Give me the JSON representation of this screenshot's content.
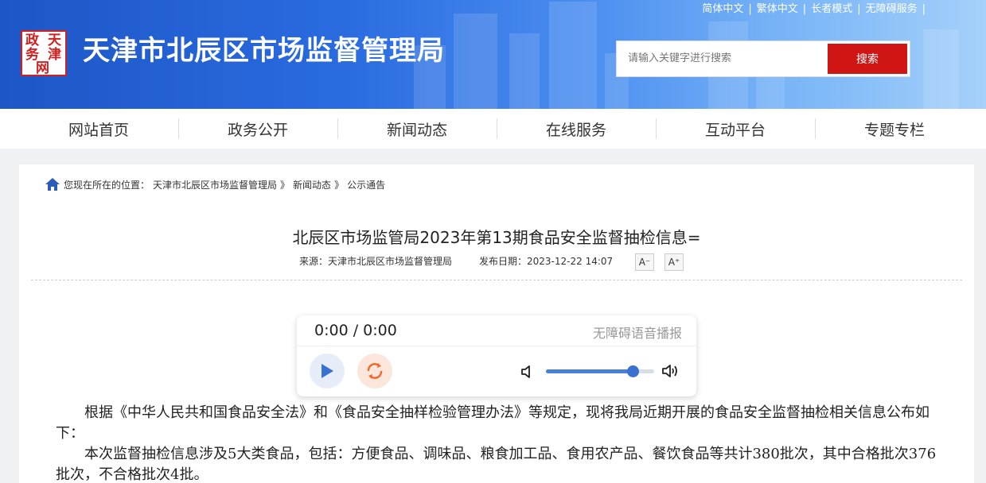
{
  "site": {
    "title": "天津市北辰区市场监督管理局",
    "logo_chars": [
      "天",
      "津",
      "政",
      "务",
      "网"
    ]
  },
  "top_links": [
    "简体中文",
    "繁体中文",
    "长者模式",
    "无障碍服务"
  ],
  "search": {
    "placeholder": "请输入关键字进行搜索",
    "button": "搜索"
  },
  "nav": {
    "items": [
      "网站首页",
      "政务公开",
      "新闻动态",
      "在线服务",
      "互动平台",
      "专题专栏"
    ]
  },
  "breadcrumb": {
    "prefix": "您现在所在的位置：",
    "items": [
      "天津市北辰区市场监督管理局",
      "新闻动态",
      "公示通告"
    ],
    "separator": "》"
  },
  "article": {
    "title": "北辰区市场监管局2023年第13期食品安全监督抽检信息=",
    "source": "来源：天津市北辰区市场监督管理局",
    "date": "发布日期：2023-12-22 14:07",
    "font_decrease": "A⁻",
    "font_increase": "A⁺",
    "paragraphs": [
      "根据《中华人民共和国食品安全法》和《食品安全抽样检验管理办法》等规定，现将我局近期开展的食品安全监督抽检相关信息公布如下：",
      "本次监督抽检信息涉及5大类食品，包括：方便食品、调味品、粮食加工品、食用农产品、餐饮食品等共计380批次，其中合格批次376批次，不合格批次4批。"
    ]
  },
  "player": {
    "time": "0:00 / 0:00",
    "label": "无障碍语音播报",
    "volume": 0.8
  },
  "colors": {
    "brand_blue": "#1d56c6",
    "search_red": "#d01515",
    "play_blue": "#3a70d0",
    "loop_orange": "#f06a2a"
  }
}
